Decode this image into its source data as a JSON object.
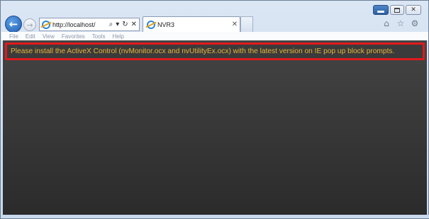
{
  "window": {
    "minimize_icon": "minimize-icon",
    "maximize_icon": "maximize-icon",
    "close_glyph": "✕"
  },
  "nav": {
    "back_glyph": "←",
    "forward_glyph": "→",
    "address_url": "http://localhost/",
    "search_glyph": "⌕",
    "dropdown_glyph": "▾",
    "refresh_glyph": "↻",
    "stop_glyph": "✕"
  },
  "tab": {
    "title": "NVR3",
    "close_glyph": "✕"
  },
  "toolbar": {
    "home_glyph": "⌂",
    "favorites_glyph": "☆",
    "settings_glyph": "⚙"
  },
  "menu": {
    "items": [
      "File",
      "Edit",
      "View",
      "Favorites",
      "Tools",
      "Help"
    ]
  },
  "content": {
    "alert_message": "Please install the ActiveX Control (nvMonitor.ocx and nvUtilityEx.ocx) with the latest version on IE pop up block prompts.",
    "alert_color": "#e6b53c",
    "alert_border_color": "#e0191d",
    "background_color": "#333333"
  }
}
